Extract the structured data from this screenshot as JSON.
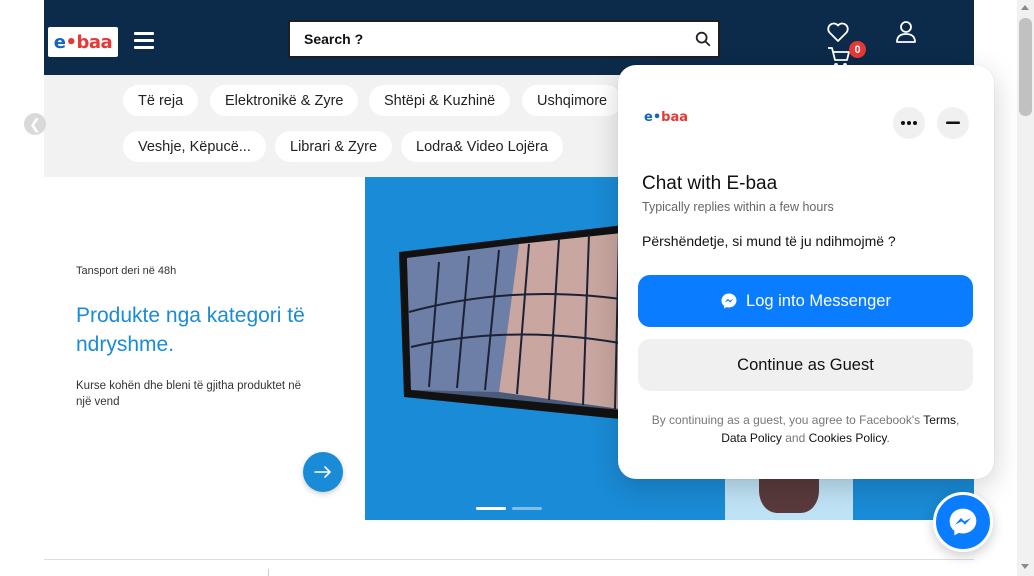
{
  "header": {
    "logo_text_e": "e",
    "logo_text_dot": "•",
    "logo_text_baa": "baa",
    "search_placeholder": "Search ?",
    "cart_count": "0",
    "colors": {
      "header_bg": "#0c2a4a",
      "accent": "#1a8bd6",
      "brand_red": "#e53935"
    }
  },
  "categories": {
    "row1": [
      "Të reja",
      "Elektronikë & Zyre",
      "Shtëpi & Kuzhinë",
      "Ushqimore"
    ],
    "row2": [
      "Veshje, Këpucë...",
      "Librari & Zyre",
      "Lodra& Video Lojëra"
    ]
  },
  "banner": {
    "kicker": "Tansport deri në 48h",
    "headline": "Produkte nga kategori të ndryshme.",
    "sub": "Kurse kohën dhe bleni të gjitha produktet në një vend",
    "slides_total": 2,
    "active_slide": 1
  },
  "chat": {
    "logo_e": "e•",
    "logo_baa": "baa",
    "more_icon": "more-icon",
    "minimize_icon": "minimize-icon",
    "title": "Chat with E-baa",
    "subtitle": "Typically replies within a few hours",
    "greeting": "Përshëndetje, si mund të ju ndihmojmë ?",
    "messenger_button": "Log into Messenger",
    "guest_button": "Continue as Guest",
    "terms_prefix": "By continuing as a guest, you agree to Facebook's",
    "terms_link": "Terms",
    "terms_comma": ",",
    "data_policy": "Data Policy",
    "and_text": "and",
    "cookies_policy": "Cookies Policy",
    "terms_end": ".",
    "colors": {
      "messenger_blue": "#0a7cff"
    }
  }
}
